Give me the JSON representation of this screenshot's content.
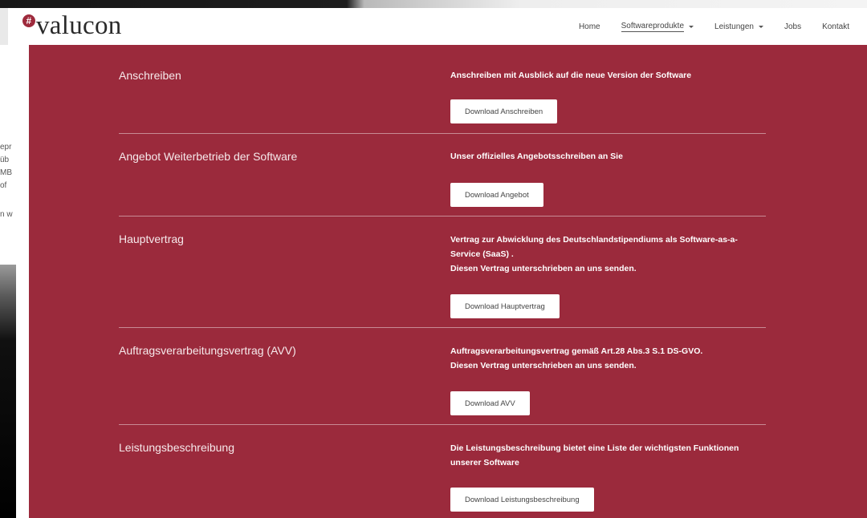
{
  "header": {
    "logo_text": "valucon",
    "logo_mark": "#",
    "nav": [
      {
        "label": "Home",
        "dropdown": false
      },
      {
        "label": "Softwareprodukte",
        "dropdown": true,
        "active": true
      },
      {
        "label": "Leistungen",
        "dropdown": true
      },
      {
        "label": "Jobs",
        "dropdown": false
      },
      {
        "label": "Kontakt",
        "dropdown": false
      }
    ]
  },
  "background_fragments": [
    "epr",
    "üb",
    "MB",
    "of",
    "n w"
  ],
  "sections": [
    {
      "title": "Anschreiben",
      "desc": [
        "Anschreiben mit Ausblick auf die neue Version der Software"
      ],
      "button": "Download Anschreiben"
    },
    {
      "title": "Angebot Weiterbetrieb der Software",
      "desc": [
        "Unser offizielles Angebotsschreiben an Sie"
      ],
      "button": "Download Angebot"
    },
    {
      "title": "Hauptvertrag",
      "desc": [
        "Vertrag zur Abwicklung des Deutschlandstipendiums als Software-as-a-",
        "Service (SaaS) .",
        "Diesen Vertrag unterschrieben an uns senden."
      ],
      "button": "Download Hauptvertrag"
    },
    {
      "title": "Auftragsverarbeitungsvertrag (AVV)",
      "desc": [
        "Auftragsverarbeitungsvertrag gemäß  Art.28 Abs.3 S.1 DS-GVO.",
        "Diesen Vertrag unterschrieben an uns senden."
      ],
      "button": "Download AVV"
    },
    {
      "title": "Leistungsbeschreibung",
      "desc": [
        "Die Leistungsbeschreibung bietet eine Liste der wichtigsten Funktionen",
        "unserer Software"
      ],
      "button": "Download Leistungsbeschreibung"
    }
  ],
  "colors": {
    "panel": "#9b2a3c",
    "accent": "#9e2a3c",
    "button_bg": "#ffffff"
  }
}
